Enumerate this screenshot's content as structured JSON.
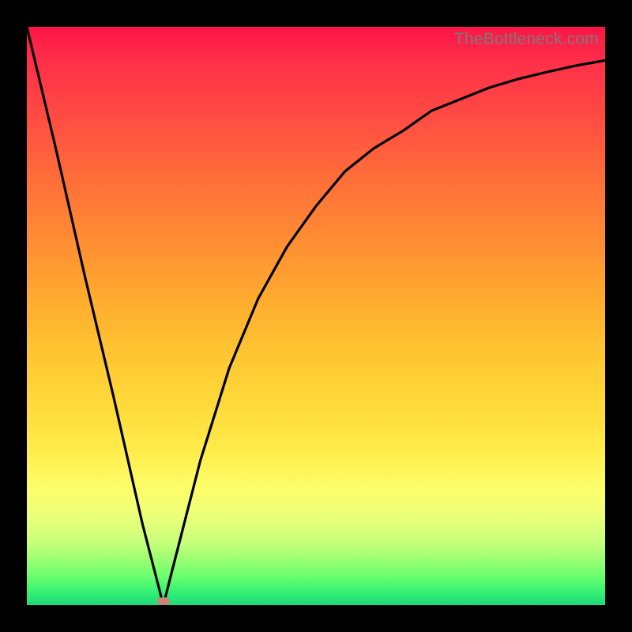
{
  "watermark": "TheBottleneck.com",
  "chart_data": {
    "type": "line",
    "title": "",
    "xlabel": "",
    "ylabel": "",
    "x": [
      0.0,
      0.05,
      0.1,
      0.15,
      0.2,
      0.236,
      0.25,
      0.3,
      0.35,
      0.4,
      0.45,
      0.5,
      0.55,
      0.6,
      0.65,
      0.7,
      0.75,
      0.8,
      0.85,
      0.9,
      0.95,
      1.0
    ],
    "values": [
      1.0,
      0.79,
      0.57,
      0.36,
      0.14,
      0.0,
      0.055,
      0.25,
      0.41,
      0.53,
      0.62,
      0.69,
      0.75,
      0.79,
      0.82,
      0.855,
      0.875,
      0.895,
      0.91,
      0.922,
      0.933,
      0.942
    ],
    "xlim": [
      0,
      1
    ],
    "ylim": [
      0,
      1
    ],
    "marker": {
      "x": 0.236,
      "y": 0.007
    },
    "note": "axes are normalized 0‒1; no tick labels shown in source image"
  }
}
